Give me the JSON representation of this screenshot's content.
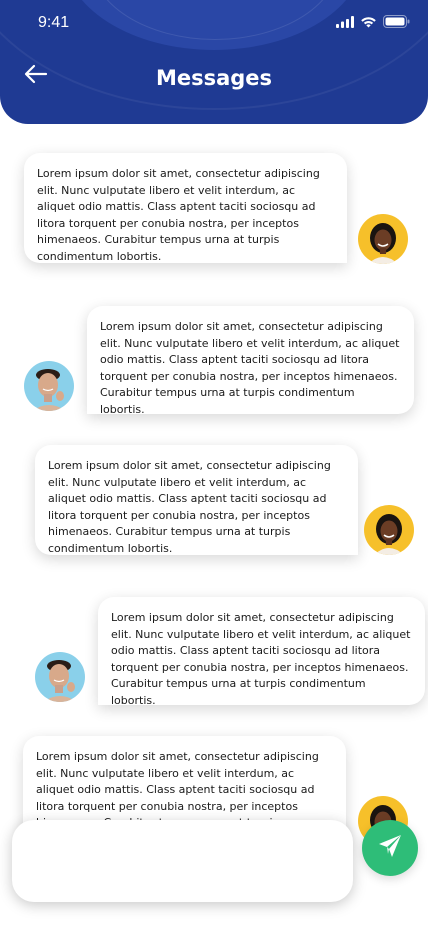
{
  "status_bar": {
    "time": "9:41"
  },
  "header": {
    "title": "Messages",
    "accent": "#1f3a93"
  },
  "messages": [
    {
      "sender": "contact",
      "text": "Lorem ipsum dolor sit amet, consectetur adipiscing elit. Nunc vulputate libero et velit interdum, ac aliquet odio mattis. Class aptent taciti sociosqu ad litora torquent per conubia nostra, per inceptos himenaeos. Curabitur tempus urna at turpis condimentum lobortis."
    },
    {
      "sender": "me",
      "text": "Lorem ipsum dolor sit amet, consectetur adipiscing elit. Nunc vulputate libero et velit interdum, ac aliquet odio mattis. Class aptent taciti sociosqu ad litora torquent per conubia nostra, per inceptos himenaeos. Curabitur tempus urna at turpis condimentum lobortis."
    },
    {
      "sender": "contact",
      "text": "Lorem ipsum dolor sit amet, consectetur adipiscing elit. Nunc vulputate libero et velit interdum, ac aliquet odio mattis. Class aptent taciti sociosqu ad litora torquent per conubia nostra, per inceptos himenaeos. Curabitur tempus urna at turpis condimentum lobortis."
    },
    {
      "sender": "me",
      "text": "Lorem ipsum dolor sit amet, consectetur adipiscing elit. Nunc vulputate libero et velit interdum, ac aliquet odio mattis. Class aptent taciti sociosqu ad litora torquent per conubia nostra, per inceptos himenaeos. Curabitur tempus urna at turpis condimentum lobortis."
    },
    {
      "sender": "contact",
      "text": "Lorem ipsum dolor sit amet, consectetur adipiscing elit. Nunc vulputate libero et velit interdum, ac aliquet odio mattis. Class aptent taciti sociosqu ad litora torquent per conubia nostra, per inceptos himenaeos. Curabitur tempus urna at turpis condimentum lobortis."
    }
  ],
  "composer": {
    "value": "",
    "placeholder": ""
  },
  "send_button": {
    "icon": "paper-plane-icon",
    "color": "#2ebd78"
  }
}
